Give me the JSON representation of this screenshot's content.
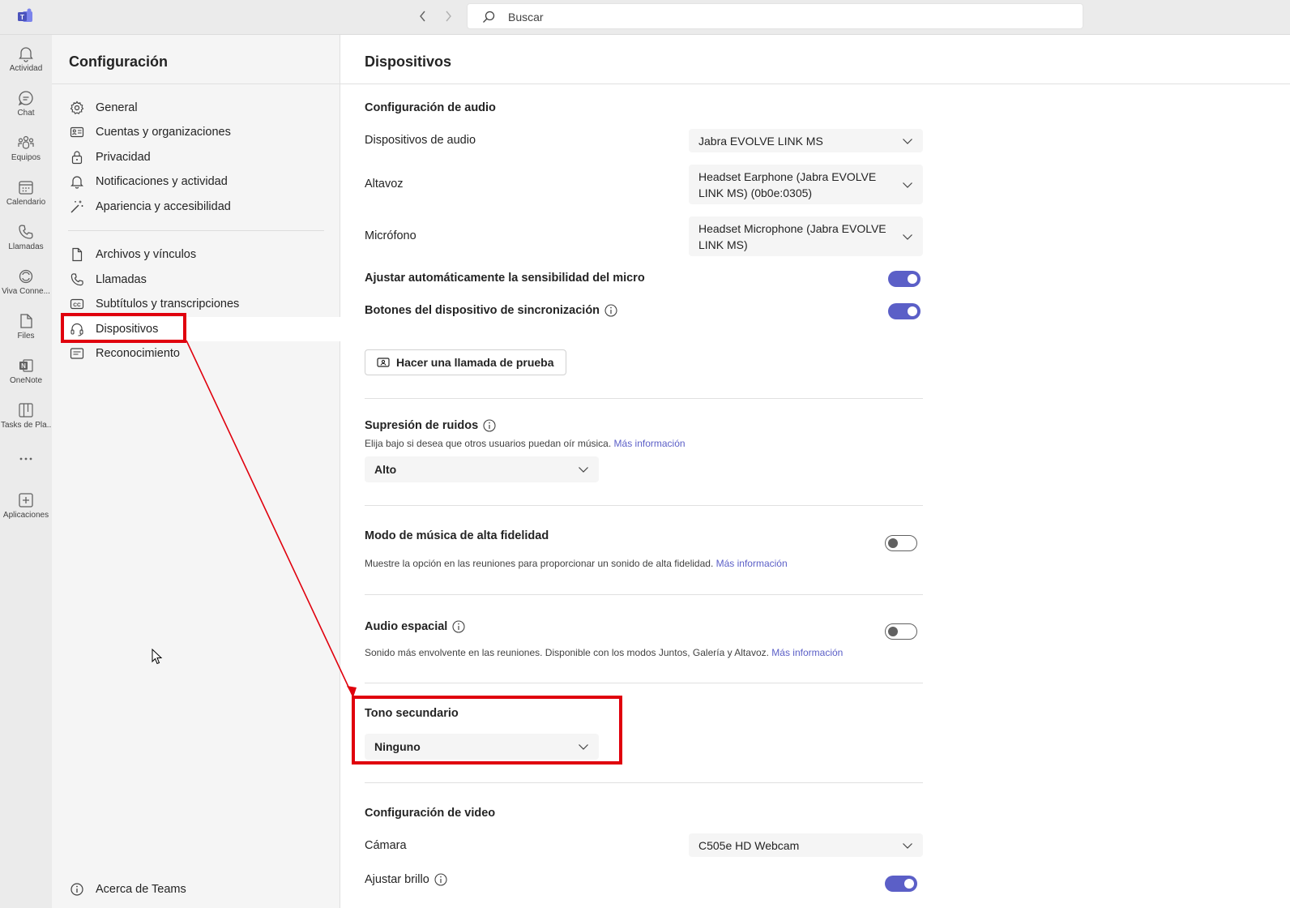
{
  "search": {
    "placeholder": "Buscar"
  },
  "rail": [
    {
      "label": "Actividad",
      "icon": "bell-icon"
    },
    {
      "label": "Chat",
      "icon": "chat-icon"
    },
    {
      "label": "Equipos",
      "icon": "teams-icon"
    },
    {
      "label": "Calendario",
      "icon": "calendar-icon"
    },
    {
      "label": "Llamadas",
      "icon": "phone-icon"
    },
    {
      "label": "Viva Conne...",
      "icon": "viva-icon"
    },
    {
      "label": "Files",
      "icon": "file-icon"
    },
    {
      "label": "OneNote",
      "icon": "onenote-icon"
    },
    {
      "label": "Tasks de Pla...",
      "icon": "planner-icon"
    },
    {
      "label": "",
      "icon": "more-icon"
    },
    {
      "label": "Aplicaciones",
      "icon": "add-app-icon"
    }
  ],
  "sidebar": {
    "title": "Configuración",
    "items": [
      {
        "label": "General",
        "icon": "gear-icon"
      },
      {
        "label": "Cuentas y organizaciones",
        "icon": "id-card-icon"
      },
      {
        "label": "Privacidad",
        "icon": "lock-icon"
      },
      {
        "label": "Notificaciones y actividad",
        "icon": "bell-icon"
      },
      {
        "label": "Apariencia y accesibilidad",
        "icon": "wand-icon"
      },
      {
        "label": "Archivos y vínculos",
        "icon": "file-icon"
      },
      {
        "label": "Llamadas",
        "icon": "phone-icon"
      },
      {
        "label": "Subtítulos y transcripciones",
        "icon": "cc-icon"
      },
      {
        "label": "Dispositivos",
        "icon": "headset-icon",
        "active": true
      },
      {
        "label": "Reconocimiento",
        "icon": "recognition-icon"
      }
    ],
    "footer": "Acerca de Teams"
  },
  "main": {
    "title": "Dispositivos",
    "audio": {
      "title": "Configuración de audio",
      "devices_label": "Dispositivos de audio",
      "devices_value": "Jabra EVOLVE LINK MS",
      "speaker_label": "Altavoz",
      "speaker_value": "Headset Earphone (Jabra EVOLVE LINK MS) (0b0e:0305)",
      "mic_label": "Micrófono",
      "mic_value": "Headset Microphone (Jabra EVOLVE LINK MS)",
      "auto_sens_label": "Ajustar automáticamente la sensibilidad del micro",
      "auto_sens_on": true,
      "sync_buttons_label": "Botones del dispositivo de sincronización",
      "sync_buttons_on": true,
      "test_call_label": "Hacer una llamada de prueba"
    },
    "noise": {
      "title": "Supresión de ruidos",
      "desc": "Elija bajo si desea que otros usuarios puedan oír música.",
      "link": "Más información",
      "value": "Alto"
    },
    "hifi": {
      "title": "Modo de música de alta fidelidad",
      "desc": "Muestre la opción en las reuniones para proporcionar un sonido de alta fidelidad.",
      "link": "Más información",
      "on": false
    },
    "spatial": {
      "title": "Audio espacial",
      "desc": "Sonido más envolvente en las reuniones. Disponible con los modos Juntos, Galería y Altavoz.",
      "link": "Más información",
      "on": false
    },
    "ringer": {
      "title": "Tono secundario",
      "value": "Ninguno"
    },
    "video": {
      "title": "Configuración de video",
      "camera_label": "Cámara",
      "camera_value": "C505e HD Webcam",
      "brightness_label": "Ajustar brillo",
      "brightness_on": true
    }
  },
  "colors": {
    "accent": "#5b5fc7",
    "highlight": "#e0000d"
  }
}
